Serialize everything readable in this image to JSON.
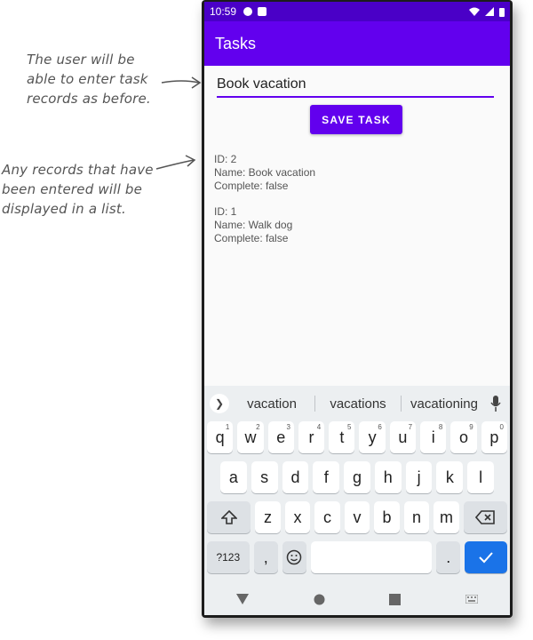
{
  "annotations": {
    "first": "The user will be\nable to enter task\nrecords as before.",
    "second": "Any records that have\nbeen entered will be\ndisplayed in a list."
  },
  "status_bar": {
    "time": "10:59"
  },
  "app_bar": {
    "title": "Tasks"
  },
  "task_input": {
    "value": "Book vacation"
  },
  "save_button": {
    "label": "SAVE TASK"
  },
  "tasks": [
    {
      "id": "ID: 2",
      "name": "Name: Book vacation",
      "complete": "Complete: false"
    },
    {
      "id": "ID: 1",
      "name": "Name: Walk dog",
      "complete": "Complete: false"
    }
  ],
  "keyboard": {
    "suggestions": [
      "vacation",
      "vacations",
      "vacationing"
    ],
    "row1": [
      {
        "k": "q",
        "n": "1"
      },
      {
        "k": "w",
        "n": "2"
      },
      {
        "k": "e",
        "n": "3"
      },
      {
        "k": "r",
        "n": "4"
      },
      {
        "k": "t",
        "n": "5"
      },
      {
        "k": "y",
        "n": "6"
      },
      {
        "k": "u",
        "n": "7"
      },
      {
        "k": "i",
        "n": "8"
      },
      {
        "k": "o",
        "n": "9"
      },
      {
        "k": "p",
        "n": "0"
      }
    ],
    "row2": [
      "a",
      "s",
      "d",
      "f",
      "g",
      "h",
      "j",
      "k",
      "l"
    ],
    "row3": [
      "z",
      "x",
      "c",
      "v",
      "b",
      "n",
      "m"
    ],
    "symbols_label": "?123",
    "comma": ",",
    "period": "."
  },
  "colors": {
    "primary": "#6200ee",
    "status_bar": "#4a00c7",
    "enter_key": "#1a73e8"
  }
}
